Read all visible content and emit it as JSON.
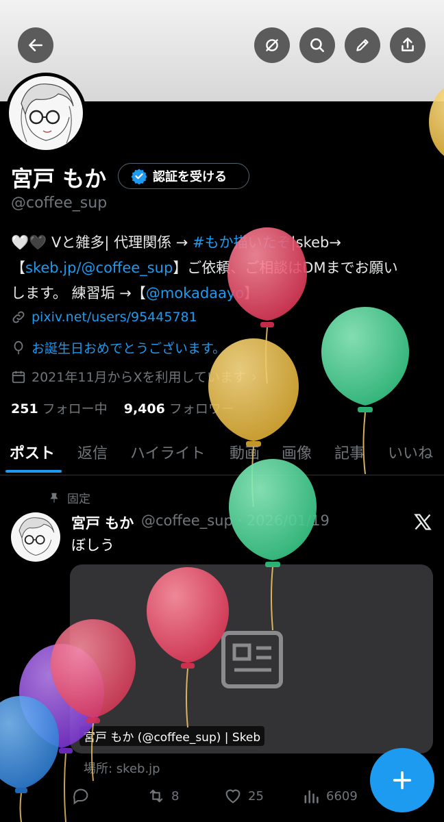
{
  "header": {
    "back_icon": "arrow-left-icon",
    "actions": [
      "grok-icon",
      "search-icon",
      "edit-icon",
      "share-icon"
    ]
  },
  "profile": {
    "name": "宮戸 もか",
    "verify_label": "認証を受ける",
    "handle": "@coffee_sup",
    "bio": {
      "line1_prefix": "🤍🖤 Vと雑多| 代理関係 → ",
      "line1_hashtag": "#もか描いたぞ",
      "line1_suffix": "|skeb→",
      "line2_open": "【",
      "line2_link": "skeb.jp/@coffee_sup",
      "line2_close": "】ご依頼、ご相談はDMまでお願い",
      "line3_prefix": "します。 練習垢 →【",
      "line3_link": "@mokadaayo",
      "line3_suffix": "】"
    },
    "website": "pixiv.net/users/95445781",
    "birthday": "お誕生日おめでとうございます。",
    "joined": "2021年11月からXを利用しています",
    "following_count": "251",
    "following_label": "フォロー中",
    "followers_count": "9,406",
    "followers_label": "フォロワー"
  },
  "tabs": [
    "ポスト",
    "返信",
    "ハイライト",
    "動画",
    "画像",
    "記事",
    "いいね"
  ],
  "pinned_post": {
    "pinned_label": "固定",
    "author_name": "宮戸 もか",
    "author_meta": "@coffee_sup · 2026/01/19",
    "text": "ぼしう",
    "card_title": "宮戸 もか (@coffee_sup) | Skeb",
    "card_source": "場所: skeb.jp",
    "retweets": "8",
    "likes": "25",
    "views": "6609"
  },
  "colors": {
    "accent": "#1d9bf0",
    "muted": "#71767b",
    "background": "#000000",
    "balloon_red": "#e0405e",
    "balloon_yellow": "#e6b93c",
    "balloon_green": "#3fcf8e",
    "balloon_purple": "#8a3fe0",
    "balloon_blue": "#2e86e0"
  }
}
